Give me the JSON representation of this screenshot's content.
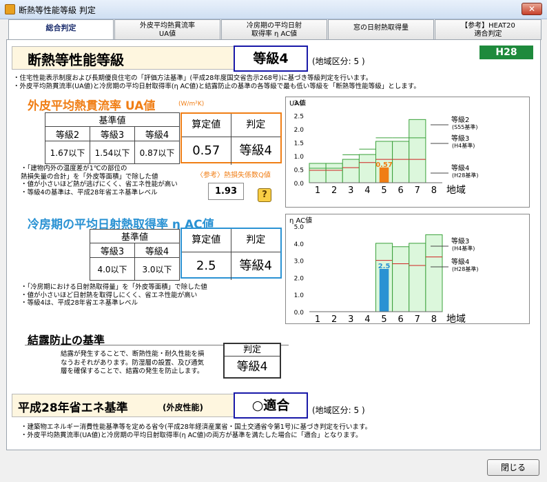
{
  "window": {
    "title": "断熱等性能等級 判定",
    "close_glyph": "✕"
  },
  "tabs": [
    {
      "label": "総合判定"
    },
    {
      "line1": "外皮平均熱貫流率",
      "line2": "UA値"
    },
    {
      "line1": "冷房期の平均日射",
      "line2": "取得率 η AC値"
    },
    {
      "label": "窓の日射熱取得量"
    },
    {
      "line1": "【参考】HEAT20",
      "line2": "適合判定"
    }
  ],
  "summary": {
    "title": "断熱等性能等級",
    "grade": "等級4",
    "region": "(地域区分: 5 )",
    "badge": "H28",
    "note1": "・住宅性能表示制度および長期優良住宅の「評価方法基準」(平成28年度国交省告示268号)に基づき等級判定を行います。",
    "note2": "・外皮平均熱貫流率(UA値)と冷房期の平均日射取得率(η AC値)と結露防止の基準の各等級で最も低い等級を「断熱等性能等級」とします。"
  },
  "ua": {
    "heading": "外皮平均熱貫流率 UA値",
    "unit": "(W/m²K)",
    "criteria_header": "基準値",
    "grade_labels": [
      "等級2",
      "等級3",
      "等級4"
    ],
    "grade_values": [
      "1.67以下",
      "1.54以下",
      "0.87以下"
    ],
    "calc_label": "算定値",
    "judge_label": "判定",
    "calc_value": "0.57",
    "judge_value": "等級4",
    "ref_label": "〈参考〉熱損失係数Q値",
    "ref_value": "1.93",
    "help_glyph": "?",
    "notes": [
      "・「建物内外の温度差が1℃の部位の",
      "  熱損失量の合計」を「外皮等面積」で除した値",
      "・値が小さいほど熱が逃げにくく、省エネ性能が高い",
      "・等級4の基準は、平成28年省エネ基準レベル"
    ]
  },
  "eta": {
    "heading": "冷房期の平均日射熱取得率 η AC値",
    "criteria_header": "基準値",
    "grade_labels": [
      "等級3",
      "等級4"
    ],
    "grade_values": [
      "4.0以下",
      "3.0以下"
    ],
    "calc_label": "算定値",
    "judge_label": "判定",
    "calc_value": "2.5",
    "judge_value": "等級4",
    "notes": [
      "・「冷房期における日射熱取得量」を「外皮等面積」で除した値",
      "・値が小さいほど日射熱を取得しにくく、省エネ性能が高い",
      "・等級4は、平成28年省エネ基準レベル"
    ]
  },
  "condensation": {
    "heading": "結露防止の基準",
    "text": [
      "結露が発生することで、断熱性能・耐久性能を損",
      "なうおそれがあります。防湿層の設置、及び通気",
      "層を確保することで、結露の発生を防止します。"
    ],
    "judge_label": "判定",
    "judge_value": "等級4"
  },
  "energy": {
    "title": "平成28年省エネ基準",
    "subtitle": "(外皮性能)",
    "result": "○適合",
    "region": "(地域区分: 5 )",
    "note1": "・建築物エネルギー消費性能基準等を定める省令(平成28年経済産業省・国土交通省令第1号)に基づき判定を行います。",
    "note2": "・外皮平均熱貫流率(UA値)と冷房期の平均日射取得率(η AC値)の両方が基準を満たした場合に「適合」となります。"
  },
  "footer": {
    "close_label": "閉じる"
  },
  "colors": {
    "orange": "#f07e15",
    "blue": "#2a92d3",
    "navy": "#1818a8",
    "green": "#1e8a3c",
    "bar_fill": "#dcf7dc",
    "bar_stroke": "#3aa03a",
    "redline": "#d02020"
  },
  "chart_data": [
    {
      "type": "bar",
      "ylabel": "UA値",
      "xlabel": "地域",
      "categories": [
        "1",
        "2",
        "3",
        "4",
        "5",
        "6",
        "7",
        "8"
      ],
      "ylim": [
        0,
        3.0
      ],
      "yticks": [
        "0.0",
        "0.5",
        "1.0",
        "1.5",
        "2.0",
        "2.5",
        "3.0"
      ],
      "grade2_limits": [
        0.72,
        0.72,
        0.87,
        1.05,
        1.54,
        1.54,
        2.35,
        null
      ],
      "grade3_limits": [
        0.54,
        0.54,
        1.04,
        1.25,
        1.67,
        1.67,
        1.67,
        null
      ],
      "grade4_limits": [
        0.46,
        0.46,
        0.56,
        0.75,
        0.87,
        0.87,
        0.87,
        null
      ],
      "current_region": "5",
      "current_value": 0.57,
      "current_label": "0.57",
      "annotations": [
        {
          "line1": "等級2",
          "line2": "(S55基準)"
        },
        {
          "line1": "等級3",
          "line2": "(H4基準)"
        },
        {
          "line1": "等級4",
          "line2": "(H28基準)"
        }
      ]
    },
    {
      "type": "bar",
      "ylabel": "η AC値",
      "xlabel": "地域",
      "categories": [
        "1",
        "2",
        "3",
        "4",
        "5",
        "6",
        "7",
        "8"
      ],
      "ylim": [
        0,
        5.0
      ],
      "yticks": [
        "0.0",
        "1.0",
        "2.0",
        "3.0",
        "4.0",
        "5.0"
      ],
      "grade3_limits": [
        null,
        null,
        null,
        null,
        4.0,
        3.8,
        4.0,
        4.5
      ],
      "grade4_limits": [
        null,
        null,
        null,
        null,
        3.0,
        2.8,
        2.7,
        3.2
      ],
      "current_region": "5",
      "current_value": 2.5,
      "current_label": "2.5",
      "annotations": [
        {
          "line1": "等級3",
          "line2": "(H4基準)"
        },
        {
          "line1": "等級4",
          "line2": "(H28基準)"
        }
      ]
    }
  ]
}
